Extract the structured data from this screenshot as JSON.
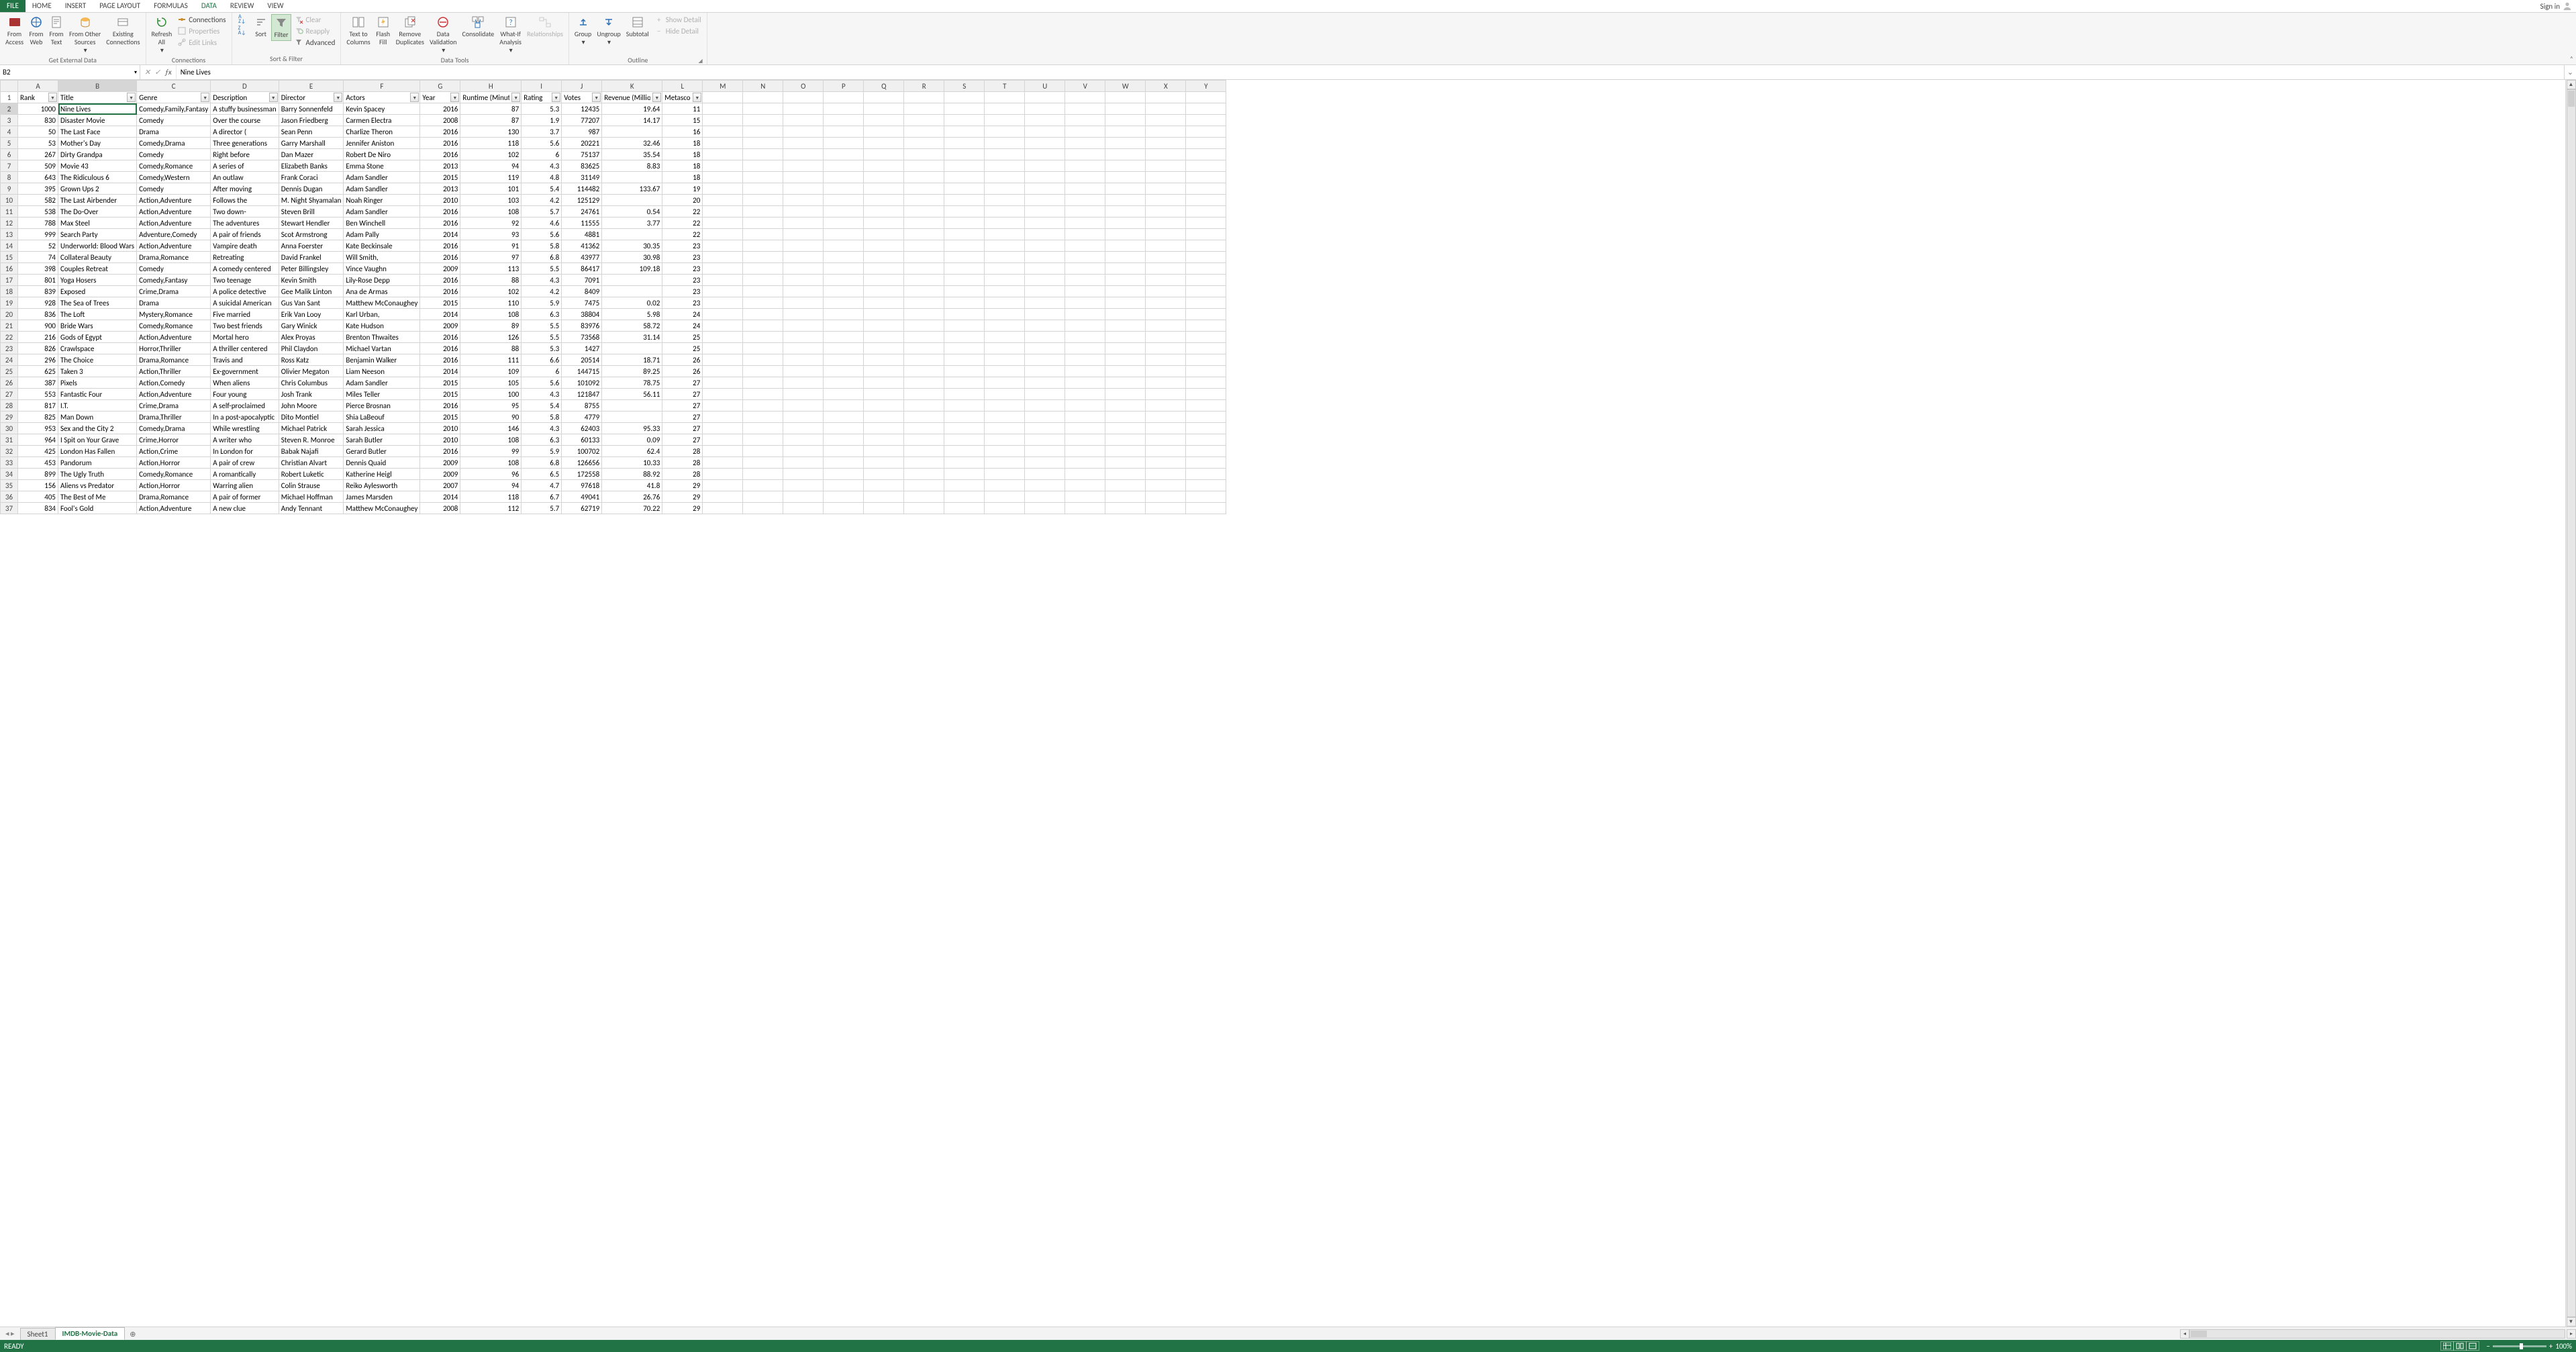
{
  "tabs": {
    "file": "FILE",
    "home": "HOME",
    "insert": "INSERT",
    "pagelayout": "PAGE LAYOUT",
    "formulas": "FORMULAS",
    "data": "DATA",
    "review": "REVIEW",
    "view": "VIEW",
    "signin": "Sign in"
  },
  "ribbon": {
    "ext": {
      "access": "From\nAccess",
      "web": "From\nWeb",
      "text": "From\nText",
      "other": "From Other\nSources",
      "existing": "Existing\nConnections",
      "title": "Get External Data"
    },
    "conn": {
      "refresh": "Refresh\nAll",
      "connections": "Connections",
      "properties": "Properties",
      "editlinks": "Edit Links",
      "title": "Connections"
    },
    "sf": {
      "sort": "Sort",
      "filter": "Filter",
      "clear": "Clear",
      "reapply": "Reapply",
      "advanced": "Advanced",
      "title": "Sort & Filter",
      "az": "A",
      "za": "Z"
    },
    "dt": {
      "ttc": "Text to\nColumns",
      "ff": "Flash\nFill",
      "rd": "Remove\nDuplicates",
      "dv": "Data\nValidation",
      "cons": "Consolidate",
      "wia": "What-If\nAnalysis",
      "rel": "Relationships",
      "title": "Data Tools"
    },
    "ol": {
      "group": "Group",
      "ungroup": "Ungroup",
      "subtotal": "Subtotal",
      "showd": "Show Detail",
      "hided": "Hide Detail",
      "title": "Outline"
    }
  },
  "namebox": "B2",
  "formula": "Nine Lives",
  "columns": [
    "A",
    "B",
    "C",
    "D",
    "E",
    "F",
    "G",
    "H",
    "I",
    "J",
    "K",
    "L",
    "M",
    "N",
    "O",
    "P",
    "Q",
    "R",
    "S",
    "T",
    "U",
    "V",
    "W",
    "X",
    "Y"
  ],
  "headers": [
    "Rank",
    "Title",
    "Genre",
    "Description",
    "Director",
    "Actors",
    "Year",
    "Runtime (Minutes)",
    "Rating",
    "Votes",
    "Revenue (Millions)",
    "Metascore"
  ],
  "rows": [
    {
      "n": 2,
      "d": [
        1000,
        "Nine Lives",
        "Comedy,Family,Fantasy",
        "A stuffy businessman",
        "Barry Sonnenfeld",
        "Kevin Spacey",
        2016,
        87,
        5.3,
        12435,
        19.64,
        11
      ]
    },
    {
      "n": 3,
      "d": [
        830,
        "Disaster Movie",
        "Comedy",
        "Over the course",
        "Jason Friedberg",
        "Carmen Electra",
        2008,
        87,
        1.9,
        77207,
        14.17,
        15
      ]
    },
    {
      "n": 4,
      "d": [
        50,
        "The Last Face",
        "Drama",
        "A director (",
        "Sean Penn",
        "Charlize Theron",
        2016,
        130,
        3.7,
        987,
        "",
        16
      ]
    },
    {
      "n": 5,
      "d": [
        53,
        "Mother's Day",
        "Comedy,Drama",
        "Three generations",
        "Garry Marshall",
        "Jennifer Aniston",
        2016,
        118,
        5.6,
        20221,
        32.46,
        18
      ]
    },
    {
      "n": 6,
      "d": [
        267,
        "Dirty Grandpa",
        "Comedy",
        "Right before",
        "Dan Mazer",
        "Robert De Niro",
        2016,
        102,
        6,
        75137,
        35.54,
        18
      ]
    },
    {
      "n": 7,
      "d": [
        509,
        "Movie 43",
        "Comedy,Romance",
        "A series of",
        "Elizabeth Banks",
        "Emma Stone",
        2013,
        94,
        4.3,
        83625,
        8.83,
        18
      ]
    },
    {
      "n": 8,
      "d": [
        643,
        "The Ridiculous 6",
        "Comedy,Western",
        "An outlaw",
        "Frank Coraci",
        "Adam Sandler",
        2015,
        119,
        4.8,
        31149,
        "",
        18
      ]
    },
    {
      "n": 9,
      "d": [
        395,
        "Grown Ups 2",
        "Comedy",
        "After moving",
        "Dennis Dugan",
        "Adam Sandler",
        2013,
        101,
        5.4,
        114482,
        133.67,
        19
      ]
    },
    {
      "n": 10,
      "d": [
        582,
        "The Last Airbender",
        "Action,Adventure",
        "Follows the",
        "M. Night Shyamalan",
        "Noah Ringer",
        2010,
        103,
        4.2,
        125129,
        "",
        20
      ]
    },
    {
      "n": 11,
      "d": [
        538,
        "The Do-Over",
        "Action,Adventure",
        "Two down-",
        "Steven Brill",
        "Adam Sandler",
        2016,
        108,
        5.7,
        24761,
        0.54,
        22
      ]
    },
    {
      "n": 12,
      "d": [
        788,
        "Max Steel",
        "Action,Adventure",
        "The adventures",
        "Stewart Hendler",
        "Ben Winchell",
        2016,
        92,
        4.6,
        11555,
        3.77,
        22
      ]
    },
    {
      "n": 13,
      "d": [
        999,
        "Search Party",
        "Adventure,Comedy",
        "A pair of friends",
        "Scot Armstrong",
        "Adam Pally",
        2014,
        93,
        5.6,
        4881,
        "",
        22
      ]
    },
    {
      "n": 14,
      "d": [
        52,
        "Underworld: Blood Wars",
        "Action,Adventure",
        "Vampire death",
        "Anna Foerster",
        "Kate Beckinsale",
        2016,
        91,
        5.8,
        41362,
        30.35,
        23
      ]
    },
    {
      "n": 15,
      "d": [
        74,
        "Collateral Beauty",
        "Drama,Romance",
        "Retreating",
        "David Frankel",
        "Will Smith,",
        2016,
        97,
        6.8,
        43977,
        30.98,
        23
      ]
    },
    {
      "n": 16,
      "d": [
        398,
        "Couples Retreat",
        "Comedy",
        "A comedy centered",
        "Peter Billingsley",
        "Vince Vaughn",
        2009,
        113,
        5.5,
        86417,
        109.18,
        23
      ]
    },
    {
      "n": 17,
      "d": [
        801,
        "Yoga Hosers",
        "Comedy,Fantasy",
        "Two teenage",
        "Kevin Smith",
        "Lily-Rose Depp",
        2016,
        88,
        4.3,
        7091,
        "",
        23
      ]
    },
    {
      "n": 18,
      "d": [
        839,
        "Exposed",
        "Crime,Drama",
        "A police detective",
        "Gee Malik Linton",
        "Ana de Armas",
        2016,
        102,
        4.2,
        8409,
        "",
        23
      ]
    },
    {
      "n": 19,
      "d": [
        928,
        "The Sea of Trees",
        "Drama",
        "A suicidal American",
        "Gus Van Sant",
        "Matthew McConaughey",
        2015,
        110,
        5.9,
        7475,
        0.02,
        23
      ]
    },
    {
      "n": 20,
      "d": [
        836,
        "The Loft",
        "Mystery,Romance",
        "Five married",
        "Erik Van Looy",
        "Karl Urban,",
        2014,
        108,
        6.3,
        38804,
        5.98,
        24
      ]
    },
    {
      "n": 21,
      "d": [
        900,
        "Bride Wars",
        "Comedy,Romance",
        "Two best friends",
        "Gary Winick",
        "Kate Hudson",
        2009,
        89,
        5.5,
        83976,
        58.72,
        24
      ]
    },
    {
      "n": 22,
      "d": [
        216,
        "Gods of Egypt",
        "Action,Adventure",
        "Mortal hero",
        "Alex Proyas",
        "Brenton Thwaites",
        2016,
        126,
        5.5,
        73568,
        31.14,
        25
      ]
    },
    {
      "n": 23,
      "d": [
        826,
        "Crawlspace",
        "Horror,Thriller",
        "A thriller centered",
        "Phil Claydon",
        "Michael Vartan",
        2016,
        88,
        5.3,
        1427,
        "",
        25
      ]
    },
    {
      "n": 24,
      "d": [
        296,
        "The Choice",
        "Drama,Romance",
        "Travis and",
        "Ross Katz",
        "Benjamin Walker",
        2016,
        111,
        6.6,
        20514,
        18.71,
        26
      ]
    },
    {
      "n": 25,
      "d": [
        625,
        "Taken 3",
        "Action,Thriller",
        "Ex-government",
        "Olivier Megaton",
        "Liam Neeson",
        2014,
        109,
        6,
        144715,
        89.25,
        26
      ]
    },
    {
      "n": 26,
      "d": [
        387,
        "Pixels",
        "Action,Comedy",
        "When aliens",
        "Chris Columbus",
        "Adam Sandler",
        2015,
        105,
        5.6,
        101092,
        78.75,
        27
      ]
    },
    {
      "n": 27,
      "d": [
        553,
        "Fantastic Four",
        "Action,Adventure",
        "Four young",
        "Josh Trank",
        "Miles Teller",
        2015,
        100,
        4.3,
        121847,
        56.11,
        27
      ]
    },
    {
      "n": 28,
      "d": [
        817,
        "I.T.",
        "Crime,Drama",
        "A self-proclaimed",
        "John Moore",
        "Pierce Brosnan",
        2016,
        95,
        5.4,
        8755,
        "",
        27
      ]
    },
    {
      "n": 29,
      "d": [
        825,
        "Man Down",
        "Drama,Thriller",
        "In a post-apocalyptic",
        "Dito Montiel",
        "Shia LaBeouf",
        2015,
        90,
        5.8,
        4779,
        "",
        27
      ]
    },
    {
      "n": 30,
      "d": [
        953,
        "Sex and the City 2",
        "Comedy,Drama",
        "While wrestling",
        "Michael Patrick",
        "Sarah Jessica",
        2010,
        146,
        4.3,
        62403,
        95.33,
        27
      ]
    },
    {
      "n": 31,
      "d": [
        964,
        "I Spit on Your Grave",
        "Crime,Horror",
        "A writer who",
        "Steven R. Monroe",
        "Sarah Butler",
        2010,
        108,
        6.3,
        60133,
        0.09,
        27
      ]
    },
    {
      "n": 32,
      "d": [
        425,
        "London Has Fallen",
        "Action,Crime",
        "In London for",
        "Babak Najafi",
        "Gerard Butler",
        2016,
        99,
        5.9,
        100702,
        62.4,
        28
      ]
    },
    {
      "n": 33,
      "d": [
        453,
        "Pandorum",
        "Action,Horror",
        "A pair of crew",
        "Christian Alvart",
        "Dennis Quaid",
        2009,
        108,
        6.8,
        126656,
        10.33,
        28
      ]
    },
    {
      "n": 34,
      "d": [
        899,
        "The Ugly Truth",
        "Comedy,Romance",
        "A romantically",
        "Robert Luketic",
        "Katherine Heigl",
        2009,
        96,
        6.5,
        172558,
        88.92,
        28
      ]
    },
    {
      "n": 35,
      "d": [
        156,
        "Aliens vs Predator",
        "Action,Horror",
        "Warring alien",
        "Colin Strause",
        "Reiko Aylesworth",
        2007,
        94,
        4.7,
        97618,
        41.8,
        29
      ]
    },
    {
      "n": 36,
      "d": [
        405,
        "The Best of Me",
        "Drama,Romance",
        "A pair of former",
        "Michael Hoffman",
        "James Marsden",
        2014,
        118,
        6.7,
        49041,
        26.76,
        29
      ]
    },
    {
      "n": 37,
      "d": [
        834,
        "Fool's Gold",
        "Action,Adventure",
        "A new clue",
        "Andy Tennant",
        "Matthew McConaughey",
        2008,
        112,
        5.7,
        62719,
        70.22,
        29
      ]
    }
  ],
  "sheets": {
    "s1": "Sheet1",
    "s2": "IMDB-Movie-Data"
  },
  "status": {
    "ready": "READY",
    "zoom": "100%"
  },
  "chart_data": {
    "type": "table",
    "note": "spreadsheet data, see rows"
  }
}
